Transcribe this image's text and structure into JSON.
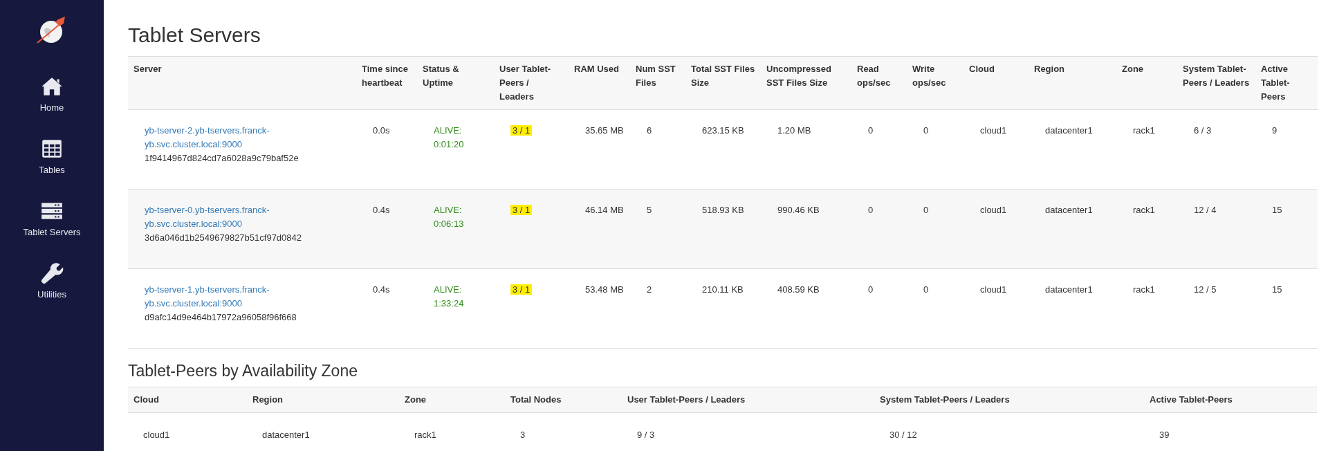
{
  "sidebar": {
    "items": [
      {
        "kind": "home",
        "label": "Home"
      },
      {
        "kind": "tables",
        "label": "Tables"
      },
      {
        "kind": "servers",
        "label": "Tablet Servers"
      },
      {
        "kind": "utilities",
        "label": "Utilities"
      }
    ]
  },
  "tablet_servers": {
    "title": "Tablet Servers",
    "columns": [
      "Server",
      "Time since heartbeat",
      "Status & Uptime",
      "User Tablet-Peers / Leaders",
      "RAM Used",
      "Num SST Files",
      "Total SST Files Size",
      "Uncompressed SST Files Size",
      "Read ops/sec",
      "Write ops/sec",
      "Cloud",
      "Region",
      "Zone",
      "System Tablet-Peers / Leaders",
      "Active Tablet-Peers"
    ],
    "rows": [
      {
        "server_link": "yb-tserver-2.yb-tservers.franck-yb.svc.cluster.local:9000",
        "server_id": "1f9414967d824cd7a6028a9c79baf52e",
        "heartbeat": "0.0s",
        "status": "ALIVE: 0:01:20",
        "user_peers": "3 / 1",
        "user_peers_highlighted": true,
        "ram": "35.65 MB",
        "num_sst": "6",
        "total_sst": "623.15 KB",
        "uncompressed_sst": "1.20 MB",
        "read_ops": "0",
        "write_ops": "0",
        "cloud": "cloud1",
        "region": "datacenter1",
        "zone": "rack1",
        "system_peers": "6 / 3",
        "active_peers": "9"
      },
      {
        "server_link": "yb-tserver-0.yb-tservers.franck-yb.svc.cluster.local:9000",
        "server_id": "3d6a046d1b2549679827b51cf97d0842",
        "heartbeat": "0.4s",
        "status": "ALIVE: 0:06:13",
        "user_peers": "3 / 1",
        "user_peers_highlighted": true,
        "ram": "46.14 MB",
        "num_sst": "5",
        "total_sst": "518.93 KB",
        "uncompressed_sst": "990.46 KB",
        "read_ops": "0",
        "write_ops": "0",
        "cloud": "cloud1",
        "region": "datacenter1",
        "zone": "rack1",
        "system_peers": "12 / 4",
        "active_peers": "15"
      },
      {
        "server_link": "yb-tserver-1.yb-tservers.franck-yb.svc.cluster.local:9000",
        "server_id": "d9afc14d9e464b17972a96058f96f668",
        "heartbeat": "0.4s",
        "status": "ALIVE: 1:33:24",
        "user_peers": "3 / 1",
        "user_peers_highlighted": true,
        "ram": "53.48 MB",
        "num_sst": "2",
        "total_sst": "210.11 KB",
        "uncompressed_sst": "408.59 KB",
        "read_ops": "0",
        "write_ops": "0",
        "cloud": "cloud1",
        "region": "datacenter1",
        "zone": "rack1",
        "system_peers": "12 / 5",
        "active_peers": "15"
      }
    ]
  },
  "zones": {
    "title": "Tablet-Peers by Availability Zone",
    "columns": [
      "Cloud",
      "Region",
      "Zone",
      "Total Nodes",
      "User Tablet-Peers / Leaders",
      "System Tablet-Peers / Leaders",
      "Active Tablet-Peers"
    ],
    "rows": [
      [
        "cloud1",
        "datacenter1",
        "rack1",
        "3",
        "9 / 3",
        "30 / 12",
        "39"
      ]
    ]
  }
}
